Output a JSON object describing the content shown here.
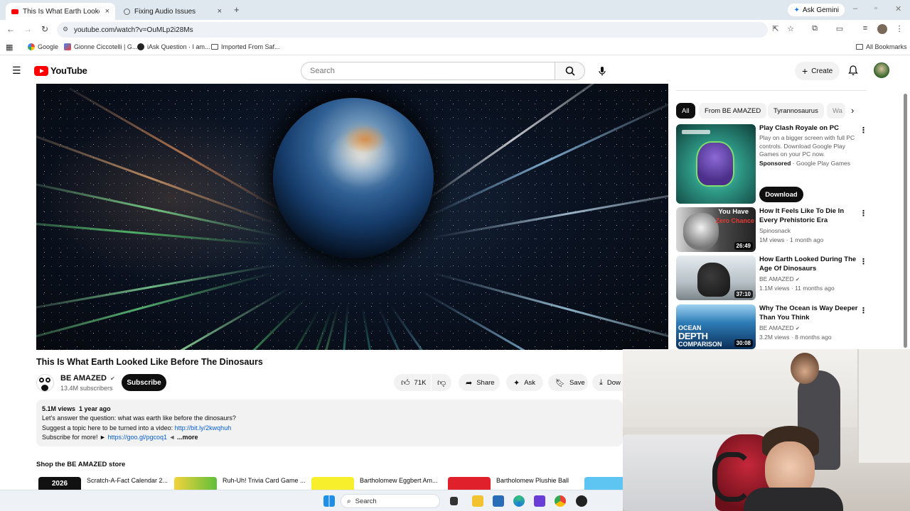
{
  "browser": {
    "tabs": [
      {
        "title": "This Is What Earth Looked Like",
        "close": "×",
        "active": true
      },
      {
        "title": "Fixing Audio Issues",
        "close": "×",
        "active": false
      }
    ],
    "new_tab": "+",
    "ask_gemini": "Ask Gemini",
    "url": "youtube.com/watch?v=OuMLp2i28Ms",
    "bookmarks": [
      "Google",
      "Gionne Ciccotelli | G...",
      "iAsk Question · I am...",
      "Imported From Saf..."
    ],
    "all_bookmarks": "All Bookmarks"
  },
  "youtube": {
    "logo_text": "YouTube",
    "search_placeholder": "Search",
    "create_label": "Create"
  },
  "video": {
    "title": "This Is What Earth Looked Like Before The Dinosaurs",
    "channel": "BE AMAZED",
    "subscribers": "13.4M subscribers",
    "subscribe_label": "Subscribe",
    "likes": "71K",
    "share_label": "Share",
    "ask_label": "Ask",
    "save_label": "Save",
    "download_label": "Dow",
    "description": {
      "views": "5.1M views",
      "age": "1 year ago",
      "line1": "Let's answer the question: what was earth like before the dinosaurs?",
      "line2_text": "Suggest a topic here to be turned into a video:",
      "line2_link": "http://bit.ly/2kwqhuh",
      "line3_text": "Subscribe for more! ►",
      "line3_link": "https://goo.gl/pgcoq1",
      "line3_arrow": "◄",
      "more": "...more"
    },
    "shop_title": "Shop the BE AMAZED store",
    "shop_items": [
      "Scratch-A-Fact Calendar 2...",
      "Ruh-Uh! Trivia Card Game ...",
      "Bartholomew Eggbert Am...",
      "Bartholomew Plushie Ball"
    ],
    "shop_thumb_1": "2026"
  },
  "sidebar": {
    "chips": [
      "All",
      "From BE AMAZED",
      "Tyrannosaurus",
      "Wa"
    ],
    "recs": [
      {
        "title": "Play Clash Royale on PC",
        "desc": "Play on a bigger screen with full PC controls. Download Google Play Games on your PC now.",
        "sponsored": "Sponsored",
        "sponsor": "· Google Play Games",
        "button": "Download"
      },
      {
        "title": "How It Feels Like To Die In Every Prehistoric Era",
        "channel": "Spinosnack",
        "meta": "1M views · 1 month ago",
        "duration": "26:49",
        "thumb_text1": "You Have",
        "thumb_text2": "Zero Chance"
      },
      {
        "title": "How Earth Looked During The Age Of Dinosaurs",
        "channel": "BE AMAZED",
        "meta": "1.1M views · 11 months ago",
        "duration": "37:10"
      },
      {
        "title": "Why The Ocean is Way Deeper Than You Think",
        "channel": "BE AMAZED",
        "meta": "3.2M views · 8 months ago",
        "duration": "30:08",
        "thumb_text1": "OCEAN",
        "thumb_text2": "DEPTH",
        "thumb_text3": "COMPARISON"
      }
    ]
  },
  "taskbar": {
    "search_placeholder": "Search"
  }
}
